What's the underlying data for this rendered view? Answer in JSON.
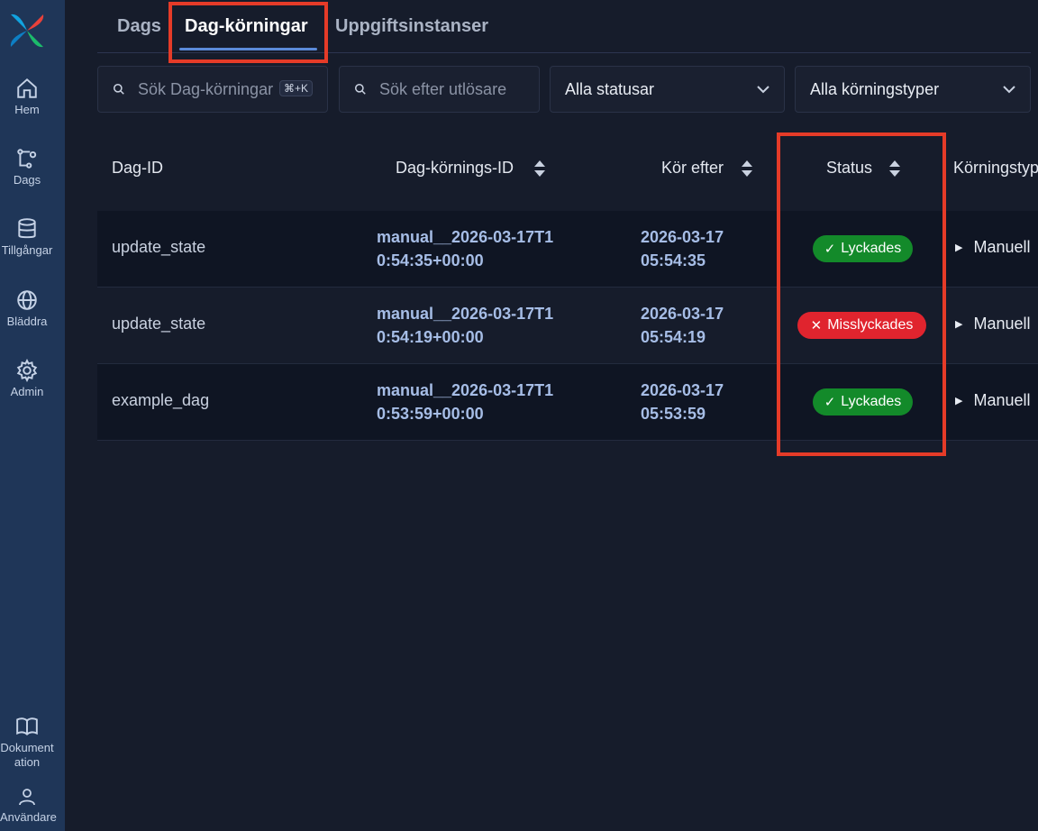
{
  "sidebar": {
    "items": [
      {
        "label": "Hem",
        "icon": "home-icon"
      },
      {
        "label": "Dags",
        "icon": "dags-icon"
      },
      {
        "label": "Tillgångar",
        "icon": "database-icon"
      },
      {
        "label": "Bläddra",
        "icon": "globe-icon"
      },
      {
        "label": "Admin",
        "icon": "gear-icon"
      }
    ],
    "bottom": [
      {
        "label": "Dokument ation",
        "icon": "book-icon"
      },
      {
        "label": "Användare",
        "icon": "user-icon"
      }
    ]
  },
  "tabs": [
    {
      "label": "Dags"
    },
    {
      "label": "Dag-körningar",
      "active": true
    },
    {
      "label": "Uppgiftsinstanser"
    }
  ],
  "filters": {
    "search_runs_placeholder": "Sök Dag-körningar",
    "search_runs_shortcut": "⌘+K",
    "search_trigger_placeholder": "Sök efter utlösare",
    "status_select": "Alla statusar",
    "runtype_select": "Alla körningstyper"
  },
  "table": {
    "headers": {
      "dag_id": "Dag-ID",
      "run_id": "Dag-körnings-ID",
      "run_after": "Kör efter",
      "status": "Status",
      "run_type": "Körningstyp"
    },
    "rows": [
      {
        "dag_id": "update_state",
        "run_id": "manual__2026-03-17T10:54:35+00:00",
        "run_after_date": "2026-03-17",
        "run_after_time": "05:54:35",
        "status": "Lyckades",
        "status_kind": "success",
        "run_type": "Manuell"
      },
      {
        "dag_id": "update_state",
        "run_id": "manual__2026-03-17T10:54:19+00:00",
        "run_after_date": "2026-03-17",
        "run_after_time": "05:54:19",
        "status": "Misslyckades",
        "status_kind": "failed",
        "run_type": "Manuell"
      },
      {
        "dag_id": "example_dag",
        "run_id": "manual__2026-03-17T10:53:59+00:00",
        "run_after_date": "2026-03-17",
        "run_after_time": "05:53:59",
        "status": "Lyckades",
        "status_kind": "success",
        "run_type": "Manuell"
      }
    ]
  },
  "colors": {
    "success": "#138a2a",
    "failed": "#e0242e",
    "highlight": "#e53b28",
    "accent": "#5b8ad9"
  }
}
